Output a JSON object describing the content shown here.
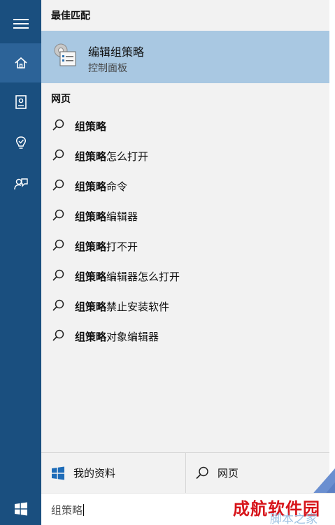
{
  "sidebar": {
    "items": [
      {
        "name": "hamburger-menu"
      },
      {
        "name": "home",
        "active": true
      },
      {
        "name": "notebook"
      },
      {
        "name": "reminders"
      },
      {
        "name": "feedback"
      }
    ],
    "accent": "#1a4f7f"
  },
  "best_match": {
    "heading": "最佳匹配",
    "title": "编辑组策略",
    "subtitle": "控制面板",
    "highlight": "#a9c8e2"
  },
  "web": {
    "heading": "网页",
    "items": [
      {
        "bold": "组策略",
        "rest": ""
      },
      {
        "bold": "组策略",
        "rest": "怎么打开"
      },
      {
        "bold": "组策略",
        "rest": "命令"
      },
      {
        "bold": "组策略",
        "rest": "编辑器"
      },
      {
        "bold": "组策略",
        "rest": "打不开"
      },
      {
        "bold": "组策略",
        "rest": "编辑器怎么打开"
      },
      {
        "bold": "组策略",
        "rest": "禁止安装软件"
      },
      {
        "bold": "组策略",
        "rest": "对象编辑器"
      }
    ]
  },
  "bottom": {
    "my_stuff": "我的资料",
    "web": "网页"
  },
  "search": {
    "value": "组策略"
  },
  "watermark": {
    "brand": "成航软件园",
    "site": "脚本之家"
  }
}
